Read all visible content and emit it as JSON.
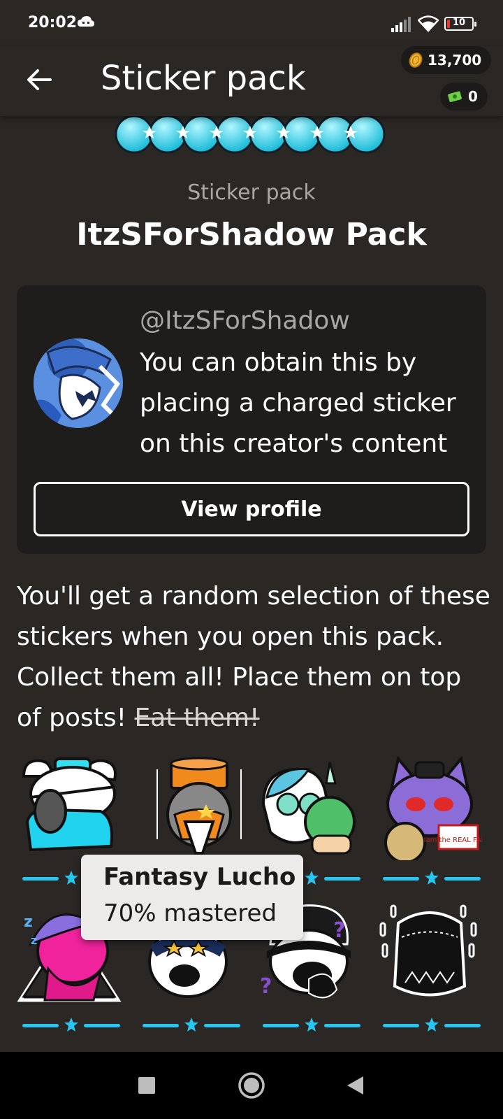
{
  "status": {
    "time": "20:02",
    "battery": "10"
  },
  "header": {
    "title": "Sticker pack",
    "coins": "13,700",
    "cash": "0"
  },
  "pack": {
    "kicker": "Sticker pack",
    "title": "ItzSForShadow Pack"
  },
  "creator": {
    "handle": "@ItzSForShadow",
    "description": "You can obtain this by placing a charged sticker on this creator's content",
    "view_profile": "View profile"
  },
  "pack_description": {
    "text": "You'll get a random selection of these stickers when you open this pack. Collect them all! Place them on top of posts! ",
    "struck": "Eat them!"
  },
  "tooltip": {
    "name": "Fantasy Lucho",
    "mastery": "70% mastered"
  },
  "stickers": [
    {
      "name": "sticker-1"
    },
    {
      "name": "sticker-2"
    },
    {
      "name": "sticker-3"
    },
    {
      "name": "sticker-4"
    },
    {
      "name": "sticker-5"
    },
    {
      "name": "sticker-6"
    },
    {
      "name": "sticker-7"
    },
    {
      "name": "sticker-8"
    }
  ],
  "sticker_badge_text": "Iam the REAL FABRI",
  "colors": {
    "background": "#2a2725",
    "card": "#1f1d1c",
    "accent": "#26c6f0",
    "muted": "#a9a6a3"
  },
  "icons": [
    "back-arrow-icon",
    "coin-icon",
    "cash-icon",
    "cloud-icon",
    "signal-icon",
    "wifi-icon",
    "battery-icon",
    "home-icon",
    "recents-icon",
    "back-icon",
    "star-icon"
  ]
}
